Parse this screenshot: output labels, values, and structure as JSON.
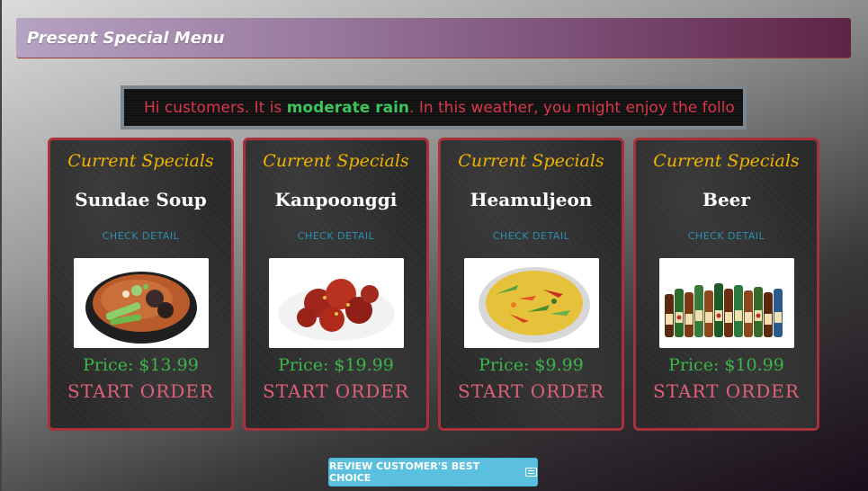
{
  "header": {
    "title": "Present Special Menu"
  },
  "marquee": {
    "prefix": "Hi customers. It is ",
    "weather": "moderate rain",
    "suffix": ". In this weather, you might enjoy the follo"
  },
  "cards": [
    {
      "heading": "Current Specials",
      "name": "Sundae Soup",
      "detail": "CHECK DETAIL",
      "price": "Price: $13.99",
      "order": "START ORDER",
      "image": "soup-image"
    },
    {
      "heading": "Current Specials",
      "name": "Kanpoonggi",
      "detail": "CHECK DETAIL",
      "price": "Price: $19.99",
      "order": "START ORDER",
      "image": "chicken-image"
    },
    {
      "heading": "Current Specials",
      "name": "Heamuljeon",
      "detail": "CHECK DETAIL",
      "price": "Price: $9.99",
      "order": "START ORDER",
      "image": "pancake-image"
    },
    {
      "heading": "Current Specials",
      "name": "Beer",
      "detail": "CHECK DETAIL",
      "price": "Price: $10.99",
      "order": "START ORDER",
      "image": "beer-image"
    }
  ],
  "review_button": {
    "label": "REVIEW CUSTOMER'S BEST CHOICE",
    "icon": "list-icon"
  },
  "colors": {
    "heading": "#f0b400",
    "price": "#3cb44a",
    "order": "#e0607a",
    "card_border": "#a8313a",
    "weather": "#3cc35a",
    "marquee_text": "#d9364a",
    "button": "#5bc0de"
  }
}
